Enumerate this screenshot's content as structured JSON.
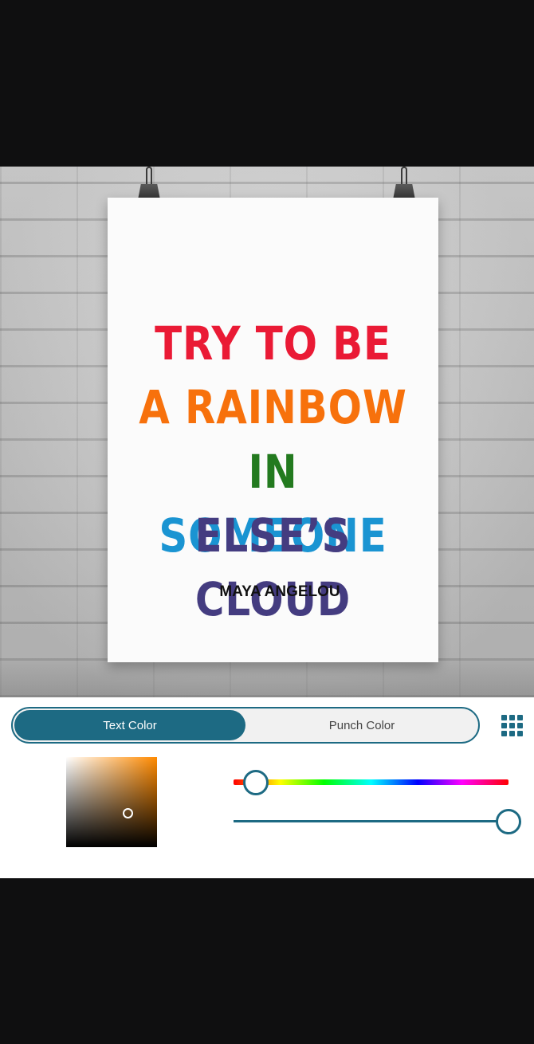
{
  "poster": {
    "quote_lines": [
      {
        "segments": [
          {
            "text": "TRY TO BE",
            "color": "#ea1a35"
          }
        ]
      },
      {
        "segments": [
          {
            "text": "A RAINBOW",
            "color": "#f7710c"
          }
        ]
      },
      {
        "segments": [
          {
            "text": "IN ",
            "color": "#237a1f"
          },
          {
            "text": "SOMEONE",
            "color": "#1a94d2"
          }
        ]
      },
      {
        "segments": [
          {
            "text": "ELSE’S CLOUD",
            "color": "#443c80"
          }
        ]
      }
    ],
    "author": "MAYA ANGELOU"
  },
  "controls": {
    "tabs": [
      {
        "label": "Text Color",
        "active": true
      },
      {
        "label": "Punch Color",
        "active": false
      }
    ],
    "grid_icon": "grid-icon",
    "accent_color": "#1d6a83",
    "picker_color": "#ff8a00",
    "hue_level": 0.08,
    "alpha_level": 1.0
  }
}
